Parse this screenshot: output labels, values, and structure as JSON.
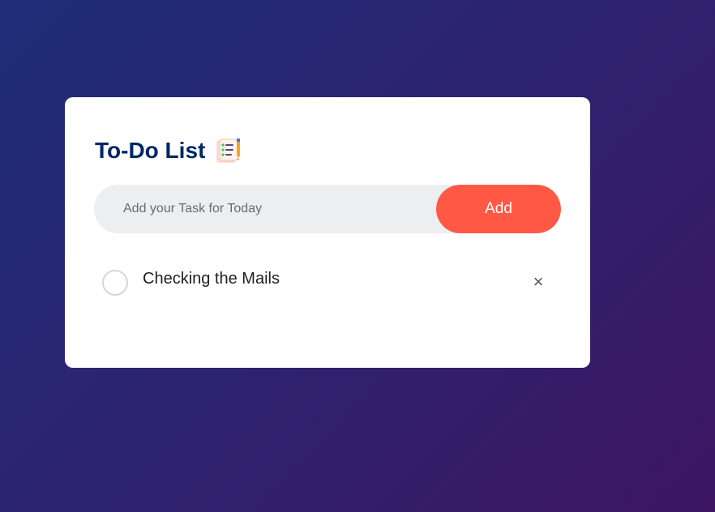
{
  "app": {
    "title": "To-Do List"
  },
  "title_icon": "notepad-pencil-icon",
  "input": {
    "placeholder": "Add your Task for Today",
    "value": ""
  },
  "add_button": {
    "label": "Add"
  },
  "tasks": [
    {
      "text": "Checking the Mails",
      "checked": false,
      "remove_glyph": "×"
    }
  ],
  "colors": {
    "title": "#002765",
    "accent": "#ff5945",
    "input_bg": "#edeef0",
    "background_start": "#1f2e78",
    "background_end": "#3d1563"
  }
}
